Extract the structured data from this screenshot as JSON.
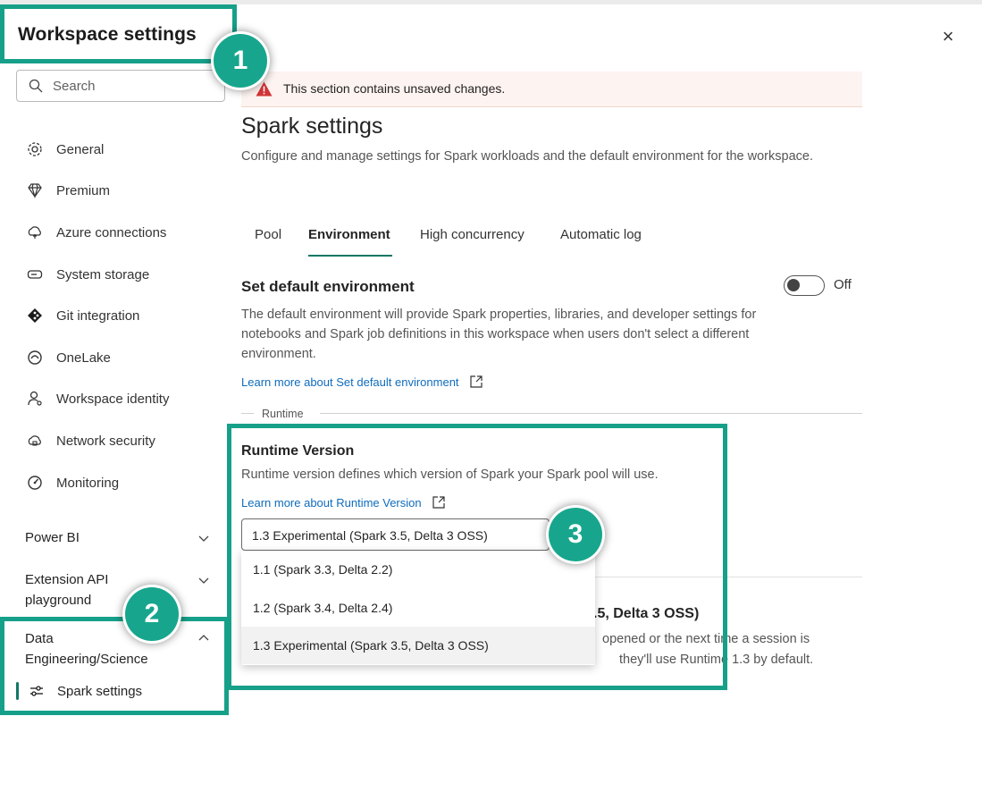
{
  "header": {
    "title": "Workspace settings",
    "close_icon": "×"
  },
  "search": {
    "placeholder": "Search"
  },
  "sidebar": {
    "items": [
      {
        "label": "General",
        "icon": "gear-icon"
      },
      {
        "label": "Premium",
        "icon": "diamond-icon"
      },
      {
        "label": "Azure connections",
        "icon": "cloud-plug-icon"
      },
      {
        "label": "System storage",
        "icon": "storage-icon"
      },
      {
        "label": "Git integration",
        "icon": "git-icon"
      },
      {
        "label": "OneLake",
        "icon": "onelake-icon"
      },
      {
        "label": "Workspace identity",
        "icon": "identity-icon"
      },
      {
        "label": "Network security",
        "icon": "cloud-lock-icon"
      },
      {
        "label": "Monitoring",
        "icon": "gauge-icon"
      }
    ],
    "sections": [
      {
        "label": "Power BI",
        "expanded": false
      },
      {
        "label": "Extension API playground",
        "expanded": false
      },
      {
        "label": "Data Engineering/Science",
        "expanded": true
      }
    ],
    "active_item": {
      "label": "Spark settings",
      "icon": "sliders-icon"
    }
  },
  "callouts": {
    "one": "1",
    "two": "2",
    "three": "3",
    "color": "#16a089"
  },
  "warning": {
    "message": "This section contains unsaved changes.",
    "color": "#d13438"
  },
  "main": {
    "title": "Spark settings",
    "description": "Configure and manage settings for Spark workloads and the default environment for the workspace.",
    "tabs": [
      {
        "label": "Pool",
        "active": false
      },
      {
        "label": "Environment",
        "active": true
      },
      {
        "label": "High concurrency",
        "active": false
      },
      {
        "label": "Automatic log",
        "active": false
      }
    ],
    "default_env": {
      "title": "Set default environment",
      "toggle_label": "Off",
      "toggle_on": false,
      "description": "The default environment will provide Spark properties, libraries, and developer settings for notebooks and Spark job definitions in this workspace when users don't select a different environment.",
      "link": "Learn more about Set default environment"
    },
    "runtime": {
      "group_label": "Runtime",
      "title": "Runtime Version",
      "description": "Runtime version defines which version of Spark your Spark pool will use.",
      "link": "Learn more about Runtime Version",
      "selected": "1.3 Experimental (Spark 3.5, Delta 3 OSS)",
      "options": [
        "1.1 (Spark 3.3, Delta 2.2)",
        "1.2 (Spark 3.4, Delta 2.4)",
        "1.3 Experimental (Spark 3.5, Delta 3 OSS)"
      ]
    },
    "obscured": {
      "title_fragment": ".5, Delta 3 OSS)",
      "line1_fragment": "opened or the next time a session is",
      "line2_fragment": "they'll use Runtime 1.3 by default."
    }
  },
  "colors": {
    "accent": "#117865",
    "link": "#0f6cbd"
  }
}
